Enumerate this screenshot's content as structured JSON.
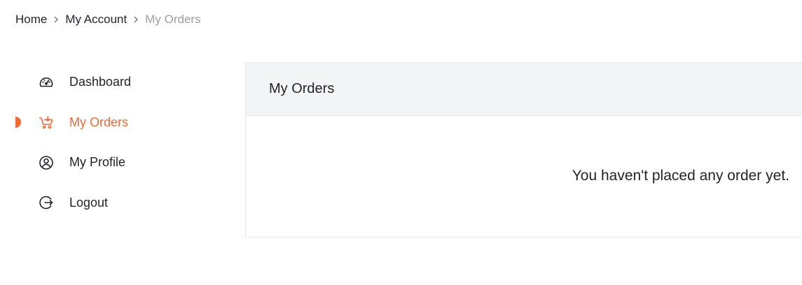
{
  "breadcrumb": {
    "items": [
      "Home",
      "My Account",
      "My Orders"
    ]
  },
  "sidebar": {
    "items": [
      {
        "label": "Dashboard",
        "icon": "dashboard-gauge-icon",
        "active": false
      },
      {
        "label": "My Orders",
        "icon": "shopping-cart-icon",
        "active": true
      },
      {
        "label": "My Profile",
        "icon": "user-circle-icon",
        "active": false
      },
      {
        "label": "Logout",
        "icon": "logout-icon",
        "active": false
      }
    ]
  },
  "main": {
    "title": "My Orders",
    "empty_message": "You haven't placed any order yet."
  },
  "colors": {
    "accent": "#ee6a34",
    "text": "#1f2328",
    "muted": "#9b9ea3",
    "panel_header_bg": "#f3f4f5",
    "border": "#e6e8eb"
  }
}
